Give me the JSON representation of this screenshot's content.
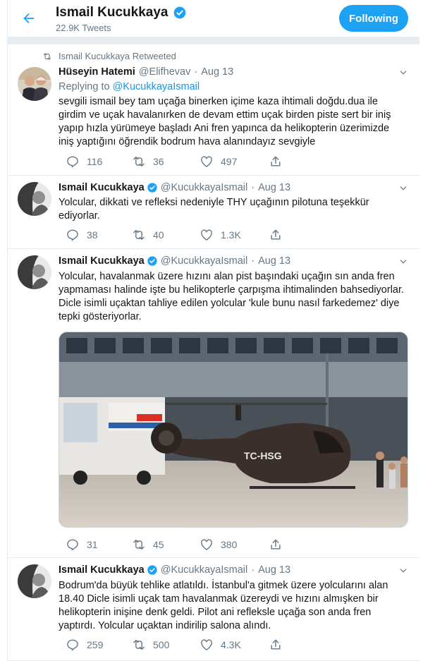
{
  "header": {
    "name": "Ismail Kucukkaya",
    "tweet_count": "22.9K Tweets",
    "follow_label": "Following",
    "accent_color": "#1da1f2"
  },
  "tweets": [
    {
      "retweet_label": "Ismail Kucukkaya Retweeted",
      "name": "Hüseyin Hatemi",
      "handle": "@Elifhevav",
      "dot": "·",
      "time": "Aug 13",
      "replying_prefix": "Replying to",
      "replying_handle": "@KucukkayaIsmail",
      "text": "sevgili ismail bey tam uçağa binerken içime kaza ihtimali doğdu.dua ile girdim ve uçak havalanırken de devam ettim uçak birden piste sert bir iniş yapıp hızla yürümeye başladı Ani fren yapınca da helikopterin üzerimizde iniş yaptığını öğrendik  bodrum hava alanındayız sevgiyle",
      "replies": "116",
      "retweets": "36",
      "likes": "497"
    },
    {
      "name": "Ismail Kucukkaya",
      "handle": "@KucukkayaIsmail",
      "dot": "·",
      "time": "Aug 13",
      "text": "Yolcular, dikkati ve refleksi nedeniyle THY uçağının pilotuna teşekkür ediyorlar.",
      "replies": "38",
      "retweets": "40",
      "likes": "1.3K"
    },
    {
      "name": "Ismail Kucukkaya",
      "handle": "@KucukkayaIsmail",
      "dot": "·",
      "time": "Aug 13",
      "text": "Yolcular, havalanmak üzere hızını alan pist başındaki uçağın sın anda fren yapmaması halinde işte bu helikopterle çarpışma ihtimalinden bahsediyorlar. Dicle isimli uçaktan tahliye edilen yolcular 'kule bunu nasıl farkedemez' diye tepki gösteriyorlar.",
      "media_registration": "TC-HSG",
      "replies": "31",
      "retweets": "45",
      "likes": "380"
    },
    {
      "name": "Ismail Kucukkaya",
      "handle": "@KucukkayaIsmail",
      "dot": "·",
      "time": "Aug 13",
      "text": "Bodrum'da büyük tehlike atlatıldı. İstanbul'a gitmek üzere yolcularını alan 18.40 Dicle isimli uçak tam havalanmak üzereydi ve hızını almışken bir helikopterin inişine denk geldi. Pilot ani refleksle uçağa son anda fren yaptırdı. Yolcular uçaktan indirilip salona alındı.",
      "replies": "259",
      "retweets": "500",
      "likes": "4.3K"
    }
  ],
  "icons": {
    "back": "arrow-left-icon",
    "verified": "verified-badge-icon",
    "reply": "reply-icon",
    "retweet": "retweet-icon",
    "like": "heart-icon",
    "share": "share-icon",
    "more": "chevron-down-icon"
  }
}
